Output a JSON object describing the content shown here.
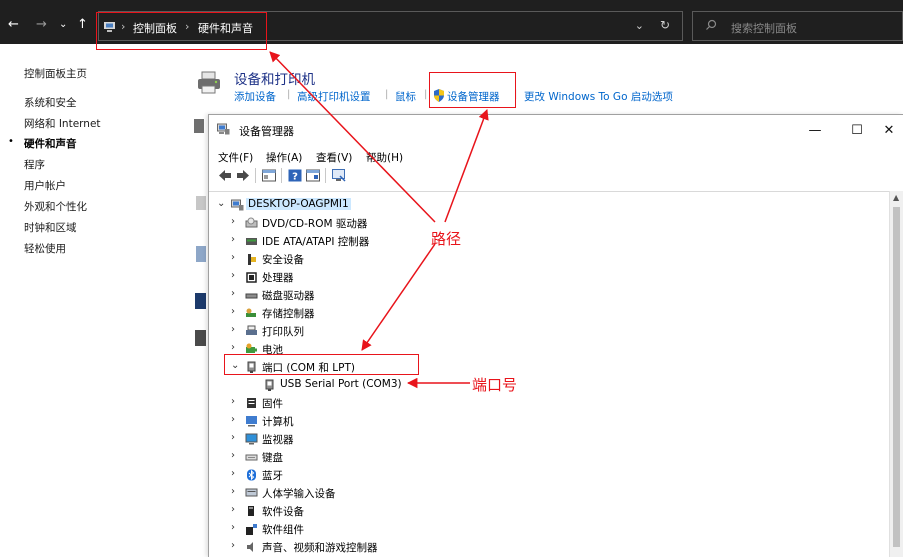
{
  "address_bar": {
    "nav_back": "←",
    "nav_forward": "→",
    "nav_recent": "⌄",
    "nav_up": "↑",
    "breadcrumb": [
      "控制面板",
      "硬件和声音"
    ],
    "separator": "›",
    "dropdown": "⌄",
    "refresh": "↻",
    "search_placeholder": "搜索控制面板"
  },
  "left_nav": {
    "items": [
      "控制面板主页",
      "系统和安全",
      "网络和 Internet",
      "硬件和声音",
      "程序",
      "用户帐户",
      "外观和个性化",
      "时钟和区域",
      "轻松使用"
    ],
    "active_index": 3,
    "bullet": "•"
  },
  "section": {
    "title": "设备和打印机",
    "links": [
      "添加设备",
      "高级打印机设置",
      "鼠标",
      "设备管理器",
      "更改 Windows To Go 启动选项"
    ],
    "separator": "|"
  },
  "device_manager": {
    "title": "设备管理器",
    "controls": {
      "minimize": "—",
      "maximize": "☐",
      "close": "✕"
    },
    "menu": [
      "文件(F)",
      "操作(A)",
      "查看(V)",
      "帮助(H)"
    ],
    "tree": {
      "root": "DESKTOP-OAGPMI1",
      "items": [
        {
          "label": "DVD/CD-ROM 驱动器",
          "icon": "dvd-drive-icon"
        },
        {
          "label": "IDE ATA/ATAPI 控制器",
          "icon": "ide-controller-icon"
        },
        {
          "label": "安全设备",
          "icon": "security-device-icon"
        },
        {
          "label": "处理器",
          "icon": "processor-icon"
        },
        {
          "label": "磁盘驱动器",
          "icon": "disk-drive-icon"
        },
        {
          "label": "存储控制器",
          "icon": "storage-controller-icon"
        },
        {
          "label": "打印队列",
          "icon": "print-queue-icon"
        },
        {
          "label": "电池",
          "icon": "battery-icon"
        },
        {
          "label": "端口 (COM 和 LPT)",
          "icon": "port-icon",
          "expanded": true
        },
        {
          "label": "USB Serial Port (COM3)",
          "icon": "port-icon",
          "child": true
        },
        {
          "label": "固件",
          "icon": "firmware-icon"
        },
        {
          "label": "计算机",
          "icon": "computer-icon"
        },
        {
          "label": "监视器",
          "icon": "monitor-icon"
        },
        {
          "label": "键盘",
          "icon": "keyboard-icon"
        },
        {
          "label": "蓝牙",
          "icon": "bluetooth-icon"
        },
        {
          "label": "人体学输入设备",
          "icon": "hid-icon"
        },
        {
          "label": "软件设备",
          "icon": "software-device-icon"
        },
        {
          "label": "软件组件",
          "icon": "software-component-icon"
        },
        {
          "label": "声音、视频和游戏控制器",
          "icon": "sound-icon"
        }
      ],
      "collapsed_glyph": "›",
      "expanded_glyph": "⌄"
    }
  },
  "annotations": {
    "path_label": "路径",
    "port_label": "端口号",
    "color": "#e8141b"
  }
}
